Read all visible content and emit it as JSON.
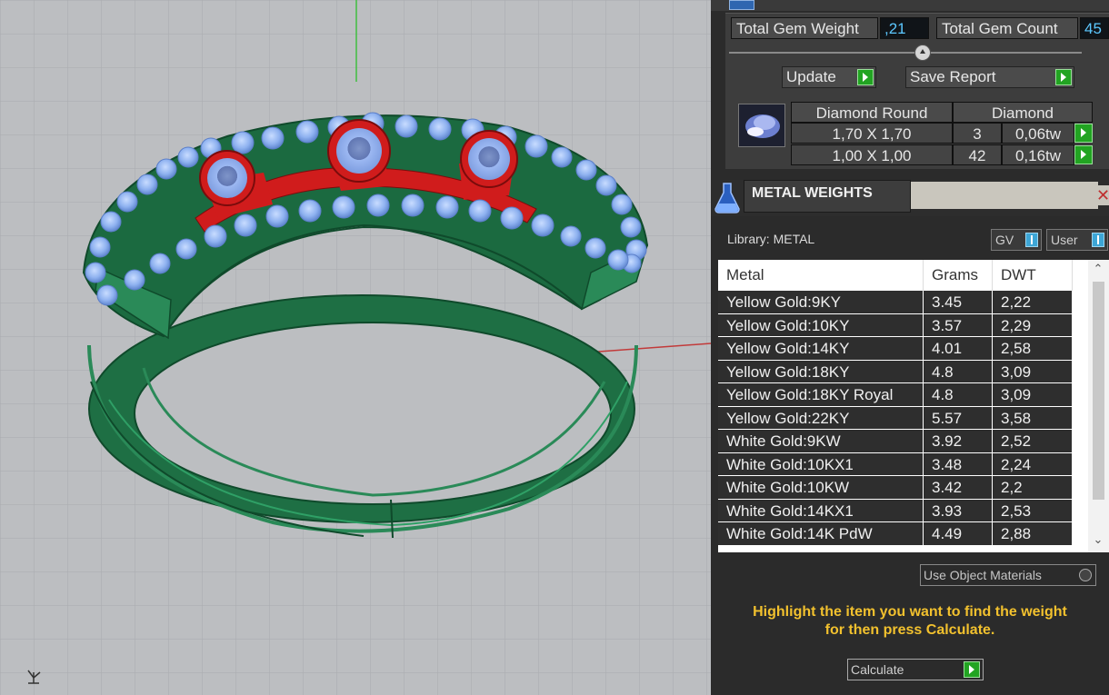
{
  "gem_summary": {
    "total_weight_label": "Total Gem Weight",
    "total_weight_value": ",21",
    "total_count_label": "Total Gem Count",
    "total_count_value": "45",
    "slider_position": 0.55,
    "update_label": "Update",
    "save_report_label": "Save Report"
  },
  "gem_table": {
    "header": [
      "Diamond Round",
      "Diamond"
    ],
    "rows": [
      {
        "size": "1,70 X 1,70",
        "count": "3",
        "weight": "0,06tw"
      },
      {
        "size": "1,00 X 1,00",
        "count": "42",
        "weight": "0,16tw"
      }
    ]
  },
  "metal_weights": {
    "title": "METAL WEIGHTS",
    "close": "✕",
    "library_label": "Library: METAL",
    "toggle_gv": "GV",
    "toggle_user": "User",
    "columns": [
      "Metal",
      "Grams",
      "DWT"
    ],
    "rows": [
      {
        "metal": "Yellow Gold:9KY",
        "grams": "3.45",
        "dwt": "2,22"
      },
      {
        "metal": "Yellow Gold:10KY",
        "grams": "3.57",
        "dwt": "2,29"
      },
      {
        "metal": "Yellow Gold:14KY",
        "grams": "4.01",
        "dwt": "2,58"
      },
      {
        "metal": "Yellow Gold:18KY",
        "grams": "4.8",
        "dwt": "3,09"
      },
      {
        "metal": "Yellow Gold:18KY Royal",
        "grams": "4.8",
        "dwt": "3,09"
      },
      {
        "metal": "Yellow Gold:22KY",
        "grams": "5.57",
        "dwt": "3,58"
      },
      {
        "metal": "White Gold:9KW",
        "grams": "3.92",
        "dwt": "2,52"
      },
      {
        "metal": "White Gold:10KX1",
        "grams": "3.48",
        "dwt": "2,24"
      },
      {
        "metal": "White Gold:10KW",
        "grams": "3.42",
        "dwt": "2,2"
      },
      {
        "metal": "White Gold:14KX1",
        "grams": "3.93",
        "dwt": "2,53"
      },
      {
        "metal": "White Gold:14K PdW",
        "grams": "4.49",
        "dwt": "2,88"
      }
    ],
    "scroll_up": "⌃",
    "scroll_down": "⌄",
    "use_object_materials_label": "Use Object Materials",
    "hint_line1": "Highlight the item you want to find the weight",
    "hint_line2": "for then press Calculate.",
    "calculate_label": "Calculate"
  },
  "colors": {
    "ring_green": "#1f7a4a",
    "gem_blue": "#8fb2f0",
    "setting_red": "#d01c1c",
    "hint_yellow": "#f2c12e",
    "go_green": "#22a422"
  },
  "icons": {
    "viewport_axis": "axis-triad-icon",
    "gem_thumbnail": "diamond-gem-icon",
    "metal_weights": "flask-icon"
  }
}
